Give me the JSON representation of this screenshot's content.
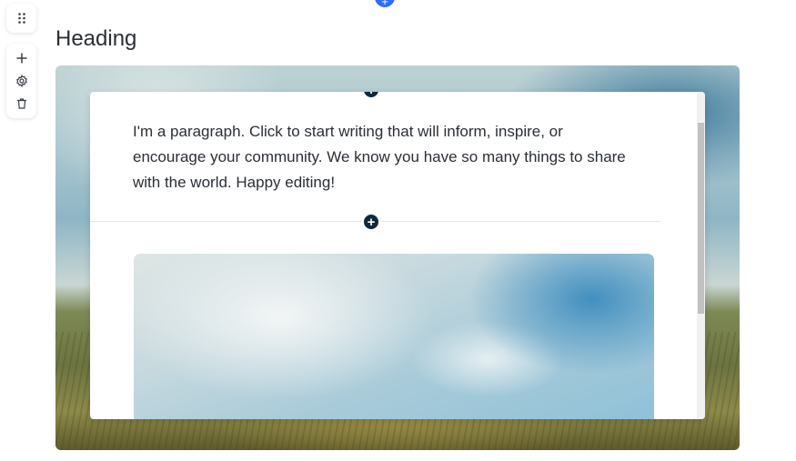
{
  "heading": "Heading",
  "paragraph": "I'm a paragraph. Click to start writing that will inform, inspire, or encourage your community. We know you have so many things to share with the world. Happy editing!",
  "icons": {
    "drag": "drag-handle-icon",
    "add": "plus-icon",
    "settings": "gear-icon",
    "delete": "trash-icon",
    "insert": "plus-circle-icon"
  },
  "colors": {
    "accent": "#2f6df6",
    "insert_dot": "#10283a",
    "text": "#2a2f36"
  }
}
